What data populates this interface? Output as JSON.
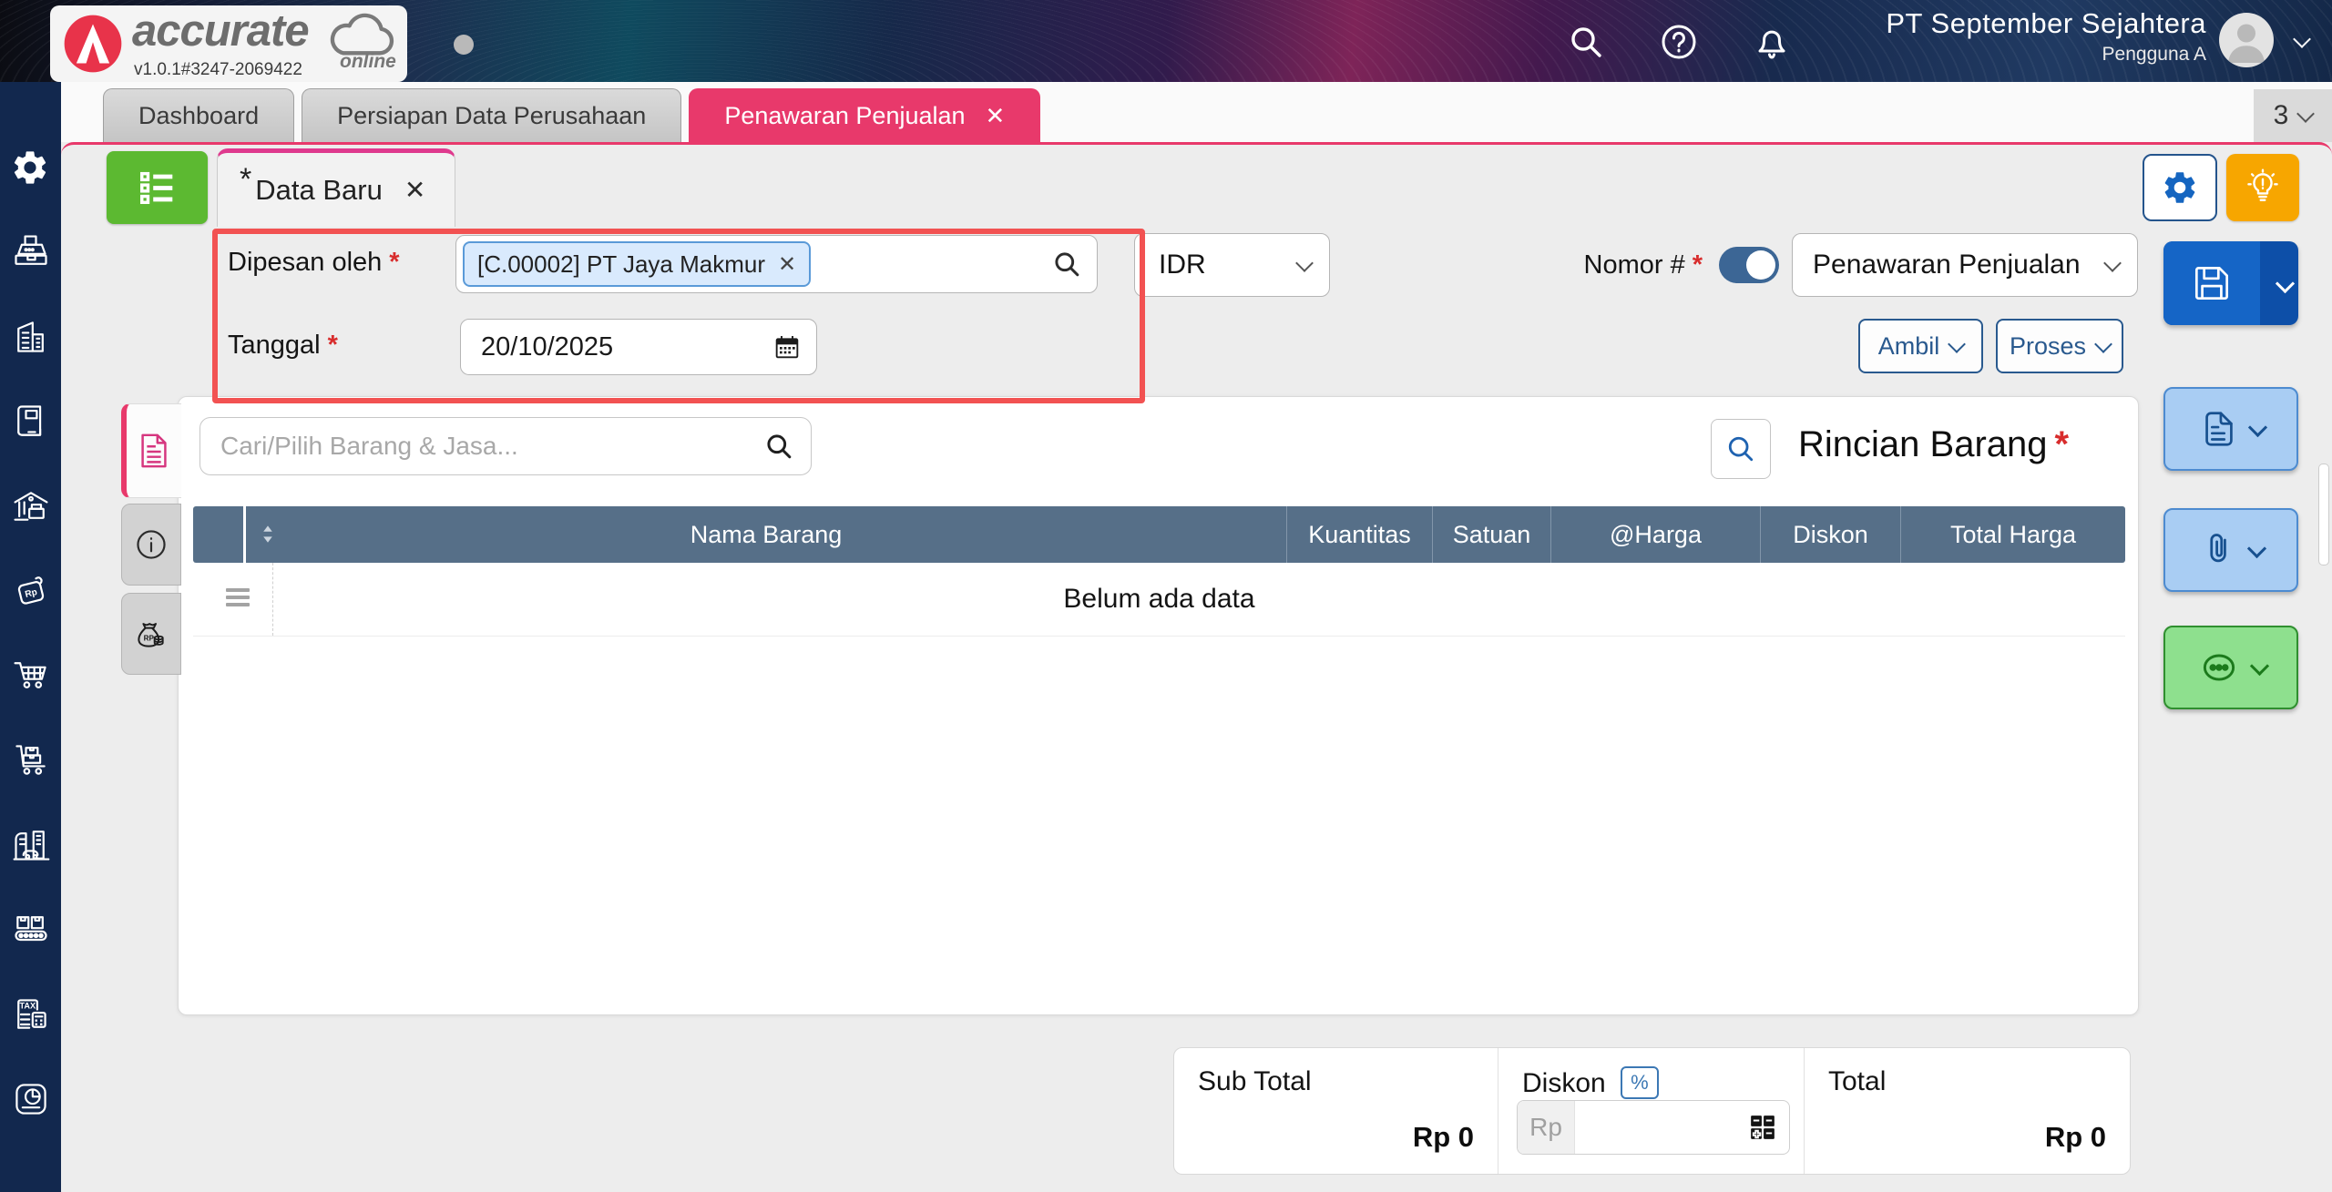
{
  "header": {
    "logo_text": "accurate",
    "logo_sub": "online",
    "version": "v1.0.1#3247-2069422",
    "company": "PT September Sejahtera",
    "user": "Pengguna A"
  },
  "tabs": [
    "Dashboard",
    "Persiapan Data Perusahaan",
    "Penawaran Penjualan"
  ],
  "tab_overflow_count": "3",
  "close_glyph": "✕",
  "subtab": {
    "dirty_marker": "*",
    "label": "Data Baru"
  },
  "form": {
    "required_marker": "*",
    "dipesan_label": "Dipesan oleh",
    "dipesan_value": "[C.00002] PT Jaya Makmur",
    "tanggal_label": "Tanggal",
    "tanggal_value": "20/10/2025",
    "currency_value": "IDR",
    "nomor_label": "Nomor #",
    "nomor_value": "Penawaran Penjualan",
    "ambil_label": "Ambil",
    "proses_label": "Proses"
  },
  "items": {
    "search_placeholder": "Cari/Pilih Barang & Jasa...",
    "title": "Rincian Barang",
    "columns": [
      "Nama Barang",
      "Kuantitas",
      "Satuan",
      "@Harga",
      "Diskon",
      "Total Harga"
    ],
    "empty_text": "Belum ada data"
  },
  "totals": {
    "subtotal_label": "Sub Total",
    "subtotal_value": "Rp 0",
    "diskon_label": "Diskon",
    "percent_badge": "%",
    "rp_prefix": "Rp",
    "total_label": "Total",
    "total_value": "Rp 0"
  },
  "sidebar_icons": [
    "settings",
    "cash-register",
    "company",
    "journal",
    "warehouse",
    "price-tag-rp",
    "shopping-cart",
    "delivery",
    "fixed-asset",
    "manufacturing",
    "tax",
    "report"
  ],
  "colors": {
    "accent_pink": "#e8396b",
    "subtab_pink": "#df3a8e",
    "highlight_red": "#f25252",
    "table_header": "#566f88",
    "green": "#5cb931",
    "save_blue": "#1565c6",
    "light_blue": "#a9cdf3",
    "light_green": "#8ee08e",
    "orange": "#f7a600",
    "sidebar_navy": "#12284e"
  }
}
